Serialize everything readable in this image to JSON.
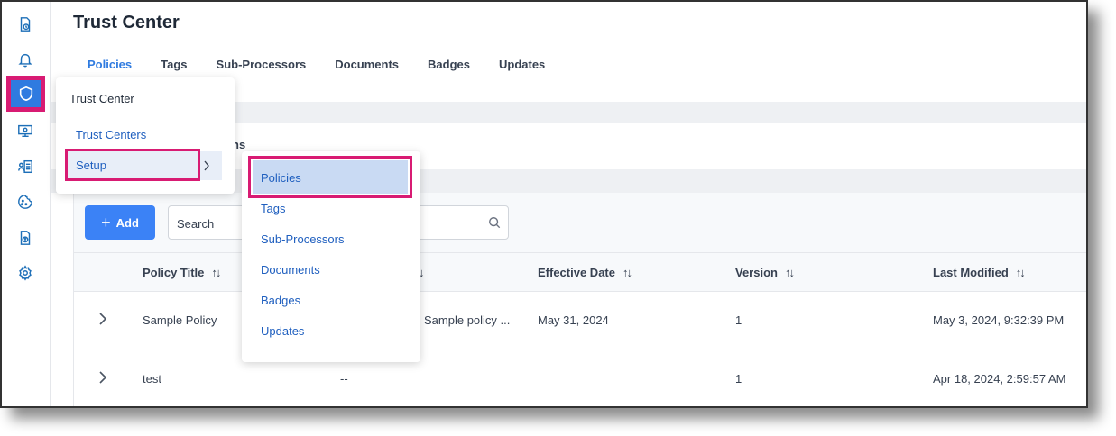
{
  "header": {
    "title": "Trust Center"
  },
  "tabs": [
    {
      "label": "Policies"
    },
    {
      "label": "Tags"
    },
    {
      "label": "Sub-Processors"
    },
    {
      "label": "Documents"
    },
    {
      "label": "Badges"
    },
    {
      "label": "Updates"
    }
  ],
  "partial_text": "ns",
  "toolbar": {
    "add_label": "Add",
    "search_placeholder": "Search"
  },
  "table": {
    "headers": [
      "Policy Title",
      "↓",
      "Effective Date",
      "Version",
      "Last Modified"
    ],
    "rows": [
      {
        "title": "Sample Policy",
        "description": "Sample policy ...",
        "effective_date": "May 31, 2024",
        "version": "1",
        "last_modified": "May 3, 2024, 9:32:39 PM"
      },
      {
        "title": "test",
        "description": "--",
        "effective_date": "",
        "version": "1",
        "last_modified": "Apr 18, 2024, 2:59:57 AM"
      }
    ]
  },
  "menu": {
    "title": "Trust Center",
    "items": [
      "Trust Centers",
      "Setup"
    ]
  },
  "submenu": {
    "items": [
      "Policies",
      "Tags",
      "Sub-Processors",
      "Documents",
      "Badges",
      "Updates"
    ]
  },
  "colors": {
    "accent": "#2f7be0",
    "highlight": "#d81b73",
    "button": "#3b82f6"
  },
  "icons": [
    "document-clock-icon",
    "bell-icon",
    "shield-icon",
    "monitor-icon",
    "contact-card-icon",
    "cookie-icon",
    "document-upload-icon",
    "gear-icon"
  ]
}
